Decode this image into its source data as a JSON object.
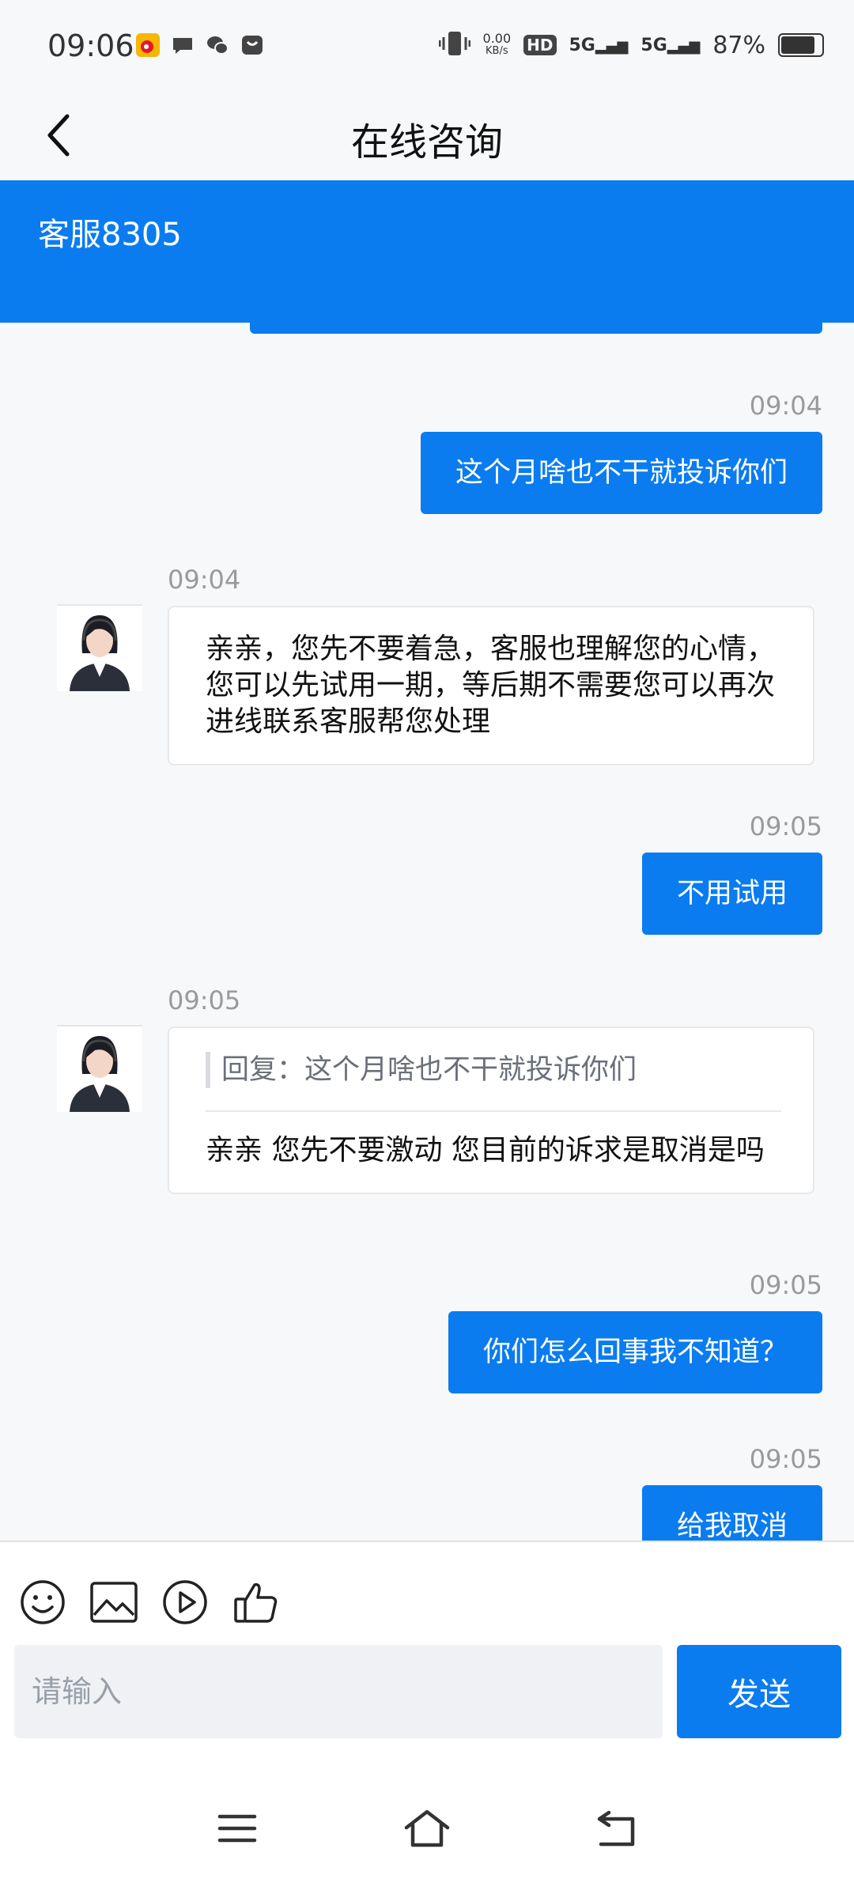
{
  "status_bar": {
    "time": "09:06",
    "speed_value": "0.00",
    "speed_unit": "KB/s",
    "hd_label": "HD",
    "net1": "5G",
    "net2": "5G",
    "battery_text": "87%",
    "battery_level": 0.87
  },
  "header": {
    "title": "在线咨询"
  },
  "agent_bar": {
    "name": "客服8305"
  },
  "messages": [
    {
      "side": "out",
      "time": "09:04",
      "text": "这个月啥也不干就投诉你们"
    },
    {
      "side": "in",
      "time": "09:04",
      "text": "亲亲，您先不要着急，客服也理解您的心情，您可以先试用一期，等后期不需要您可以再次进线联系客服帮您处理"
    },
    {
      "side": "out",
      "time": "09:05",
      "text": "不用试用"
    },
    {
      "side": "in",
      "time": "09:05",
      "quote": "回复：这个月啥也不干就投诉你们",
      "text": "亲亲 您先不要激动 您目前的诉求是取消是吗"
    },
    {
      "side": "out",
      "time": "09:05",
      "text": "你们怎么回事我不知道？"
    },
    {
      "side": "out",
      "time": "09:05",
      "text": "给我取消"
    }
  ],
  "input": {
    "placeholder": "请输入",
    "send_label": "发送"
  },
  "colors": {
    "accent": "#0a7cf0",
    "background": "#f7f8fa"
  },
  "icons": {
    "toolbar": [
      "emoji-icon",
      "image-icon",
      "video-play-icon",
      "thumbs-up-icon"
    ],
    "nav": [
      "menu-icon",
      "home-icon",
      "back-icon"
    ]
  }
}
